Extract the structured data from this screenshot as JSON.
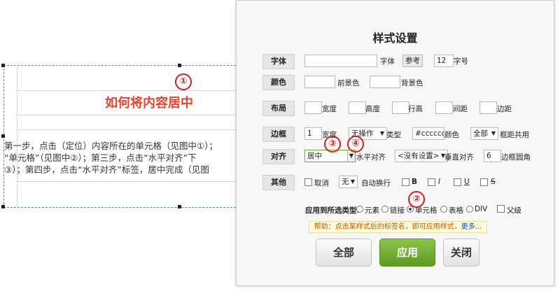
{
  "doc": {
    "title": "如何将内容居中",
    "lines": [
      "第一步，点击（定位）内容所在的单元格（见图中①）；",
      "“单元格”（见图中②）；第三步，点击“水平对齐”下",
      "③）；第四步，点击“水平对齐”标签，居中完成（见图"
    ]
  },
  "markers": [
    "①",
    "②",
    "③",
    "④"
  ],
  "dialog": {
    "title": "样式设置",
    "font": {
      "label": "字体",
      "value": "",
      "font_suffix": "字体",
      "ref_button": "参考",
      "size_value": "12",
      "size_suffix": "字号"
    },
    "color": {
      "label": "颜色",
      "fg_value": "",
      "fg_suffix": "前景色",
      "bg_value": "",
      "bg_suffix": "背景色"
    },
    "layout": {
      "label": "布局",
      "fields": [
        "宽度",
        "高度",
        "行高",
        "间距",
        "边距"
      ]
    },
    "border": {
      "label": "边框",
      "width_value": "1",
      "width_suffix": "宽度",
      "type_value": "无操作",
      "type_suffix": "类型",
      "color_value": "#cccccc",
      "color_suffix": "颜色",
      "scope_value": "全部",
      "scope_suffix": "框距共用"
    },
    "align": {
      "label": "对齐",
      "h_value": "居中",
      "h_suffix": "水平对齐",
      "v_value": "<没有设置>",
      "v_suffix": "垂直对齐",
      "radius_value": "6",
      "radius_suffix": "边框圆角"
    },
    "other": {
      "label": "其他",
      "cancel": "取消",
      "wrap_value": "无",
      "wrap_suffix": "自动换行",
      "bold": "B",
      "italic": "I",
      "underline": "U",
      "strike": "S"
    },
    "apply_types": {
      "label": "应用到所选类型:",
      "options": [
        "元素",
        "链接",
        "单元格",
        "表格",
        "DIV"
      ],
      "selected": "单元格",
      "parent": "父级"
    },
    "help": {
      "text": "帮助：点击某样式后的标签名，即可应用样式，",
      "more": "更多..."
    },
    "buttons": {
      "all": "全部",
      "apply": "应用",
      "close": "关闭"
    }
  },
  "colors": {
    "accent_green": "#6aaa2a",
    "marker_red": "#d81e1e",
    "title_red": "#e8432e"
  }
}
